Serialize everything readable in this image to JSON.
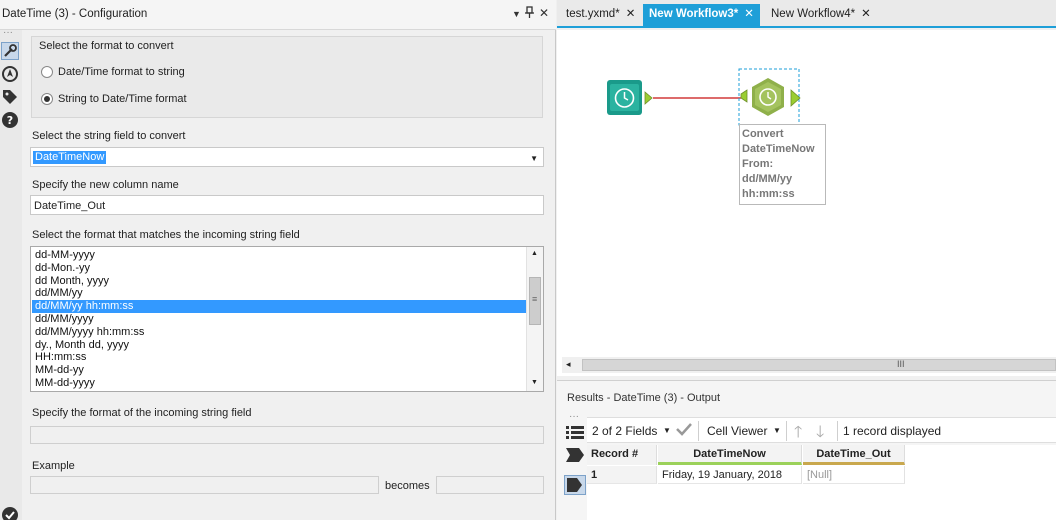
{
  "config": {
    "title": "DateTime (3) - Configuration",
    "pin_glyph": "▼",
    "pushpin_glyph": "⊥",
    "close_glyph": "✕",
    "convert_group_label": "Select the format to convert",
    "radio_options": [
      "Date/Time format to string",
      "String to Date/Time format"
    ],
    "selected_radio": 1,
    "string_field_label": "Select the string field to convert",
    "string_field_value": "DateTimeNow",
    "new_column_label": "Specify the new column name",
    "new_column_value": "DateTime_Out",
    "format_list_label": "Select the format that matches the incoming string field",
    "format_list": [
      "dd-MM-yyyy",
      "dd-Mon.-yy",
      "dd Month, yyyy",
      "dd/MM/yy",
      "dd/MM/yy hh:mm:ss",
      "dd/MM/yyyy",
      "dd/MM/yyyy hh:mm:ss",
      "dy., Month dd, yyyy",
      "HH:mm:ss",
      "MM-dd-yy",
      "MM-dd-yyyy"
    ],
    "format_selected_index": 4,
    "incoming_format_label": "Specify the format of the incoming string field",
    "incoming_format_value": "",
    "example_label": "Example",
    "example_input": "",
    "becomes_label": "becomes",
    "example_output": "",
    "strip_dots": "···"
  },
  "tabs": [
    {
      "label": "test.yxmd*",
      "active": false
    },
    {
      "label": "New Workflow3*",
      "active": true
    },
    {
      "label": "New Workflow4*",
      "active": false
    }
  ],
  "canvas": {
    "annotation_lines": [
      "Convert",
      "DateTimeNow",
      "From:",
      "dd/MM/yy",
      "hh:mm:ss"
    ],
    "hscroll_grip": "III",
    "hscroll_left": "◂"
  },
  "results": {
    "title": "Results - DateTime (3) - Output",
    "side_dots": "···",
    "fields_label": "2 of 2 Fields",
    "viewer_label": "Cell Viewer",
    "record_count": "1 record displayed",
    "columns": [
      "Record #",
      "DateTimeNow",
      "DateTime_Out"
    ],
    "rows": [
      {
        "record": "1",
        "DateTimeNow": "Friday, 19 January, 2018",
        "DateTime_Out": "[Null]"
      }
    ]
  },
  "colors": {
    "accent": "#1e9fd8",
    "tool_teal": "#1a9a8a",
    "tool_green": "#8fb04a",
    "connector_red": "#d23a3a"
  }
}
